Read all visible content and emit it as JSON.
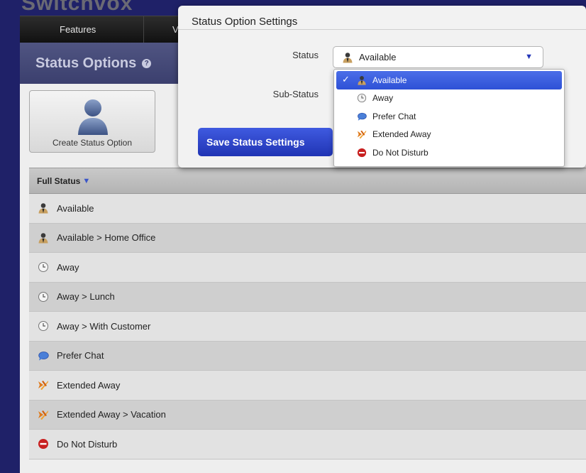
{
  "app": {
    "logo_text": "Switchvox"
  },
  "topnav": {
    "tabs": [
      "Features",
      "Vo"
    ]
  },
  "page": {
    "title": "Status Options",
    "help_icon": "?"
  },
  "create_card": {
    "label": "Create Status Option"
  },
  "table": {
    "header": "Full Status",
    "rows": [
      {
        "label": "Available",
        "icon": "person-icon"
      },
      {
        "label": "Available > Home Office",
        "icon": "person-icon"
      },
      {
        "label": "Away",
        "icon": "clock-icon"
      },
      {
        "label": "Away > Lunch",
        "icon": "clock-icon"
      },
      {
        "label": "Away > With Customer",
        "icon": "clock-icon"
      },
      {
        "label": "Prefer Chat",
        "icon": "chat-bubble-icon"
      },
      {
        "label": "Extended Away",
        "icon": "plane-icon"
      },
      {
        "label": "Extended Away > Vacation",
        "icon": "plane-icon"
      },
      {
        "label": "Do Not Disturb",
        "icon": "no-entry-icon"
      }
    ]
  },
  "modal": {
    "title": "Status Option Settings",
    "status_label": "Status",
    "substatus_label": "Sub-Status",
    "status_value": "Available",
    "save_label": "Save Status Settings",
    "options": [
      {
        "label": "Available",
        "icon": "person-icon",
        "selected": true
      },
      {
        "label": "Away",
        "icon": "clock-icon",
        "selected": false
      },
      {
        "label": "Prefer Chat",
        "icon": "chat-bubble-icon",
        "selected": false
      },
      {
        "label": "Extended Away",
        "icon": "plane-icon",
        "selected": false
      },
      {
        "label": "Do Not Disturb",
        "icon": "no-entry-icon",
        "selected": false
      }
    ]
  },
  "colors": {
    "brand_blue": "#2034b4",
    "selected_blue": "#2e51d6",
    "title_bar": "#3b3f6e"
  }
}
